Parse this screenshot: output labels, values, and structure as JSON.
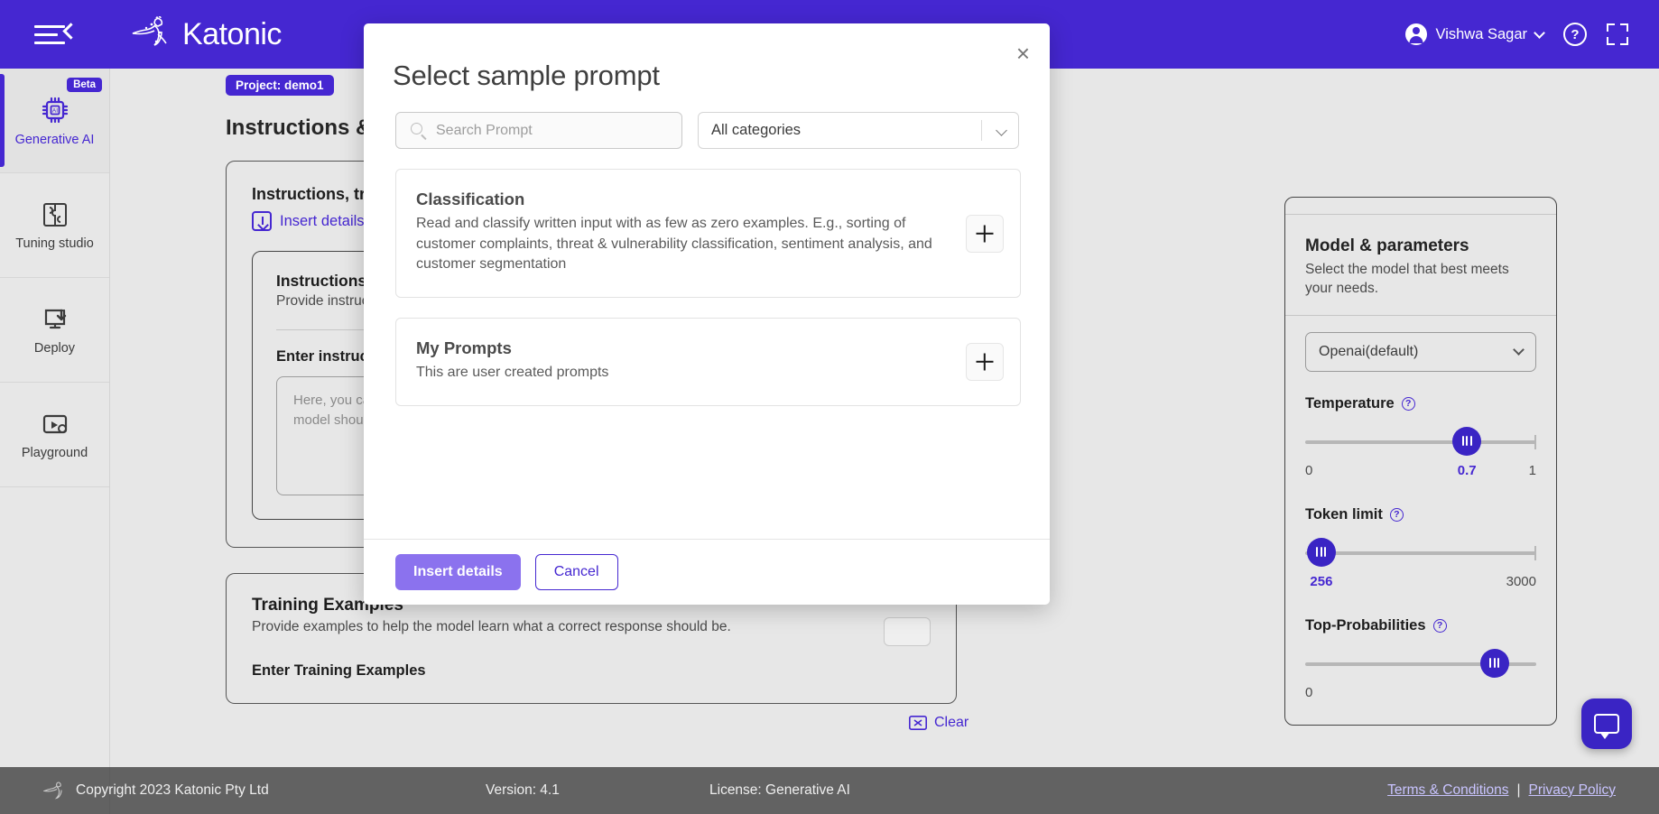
{
  "topbar": {
    "brand": "Katonic",
    "menu_icon": "hamburger-collapse-icon",
    "user_name": "Vishwa Sagar",
    "help_label": "?",
    "fullscreen_icon": "expand-icon"
  },
  "sidebar": {
    "items": [
      {
        "label": "Generative AI",
        "icon": "ai-chip-icon",
        "badge": "Beta",
        "active": true
      },
      {
        "label": "Tuning studio",
        "icon": "puzzle-icon",
        "badge": "",
        "active": false
      },
      {
        "label": "Deploy",
        "icon": "deploy-monitor-icon",
        "badge": "",
        "active": false
      },
      {
        "label": "Playground",
        "icon": "playground-icon",
        "badge": "",
        "active": false
      }
    ]
  },
  "page": {
    "project_chip": "Project: demo1",
    "title": "Instructions & Settings",
    "section_title": "Instructions, training examples and test i",
    "insert_link": "Insert details from sample prompt",
    "instructions_title": "Instructions",
    "instructions_sub": "Provide instructions to the model abou",
    "enter_instructions_label": "Enter instructions",
    "instructions_placeholder_line1": "Here, you can provide a clear descripti",
    "instructions_placeholder_line2": "model should respond to.",
    "training_title": "Training Examples",
    "training_sub": "Provide examples to help the model learn what a correct response should be.",
    "enter_training_label": "Enter Training Examples"
  },
  "params": {
    "title": "Model & parameters",
    "subtitle": "Select the model that best meets your needs.",
    "model_value": "Openai(default)",
    "temperature_label": "Temperature",
    "temperature_value": "0.7",
    "temperature_min": "0",
    "temperature_max": "1",
    "token_label": "Token limit",
    "token_value": "256",
    "token_min": "0",
    "token_max": "3000",
    "topp_label": "Top-Probabilities",
    "topp_min": "0"
  },
  "modal": {
    "title": "Select sample prompt",
    "close_label": "×",
    "search_placeholder": "Search Prompt",
    "search_value": "",
    "category_value": "All categories",
    "cards": [
      {
        "title": "Classification",
        "description": "Read and classify written input with as few as zero examples. E.g., sorting of customer complaints, threat & vulnerability classification, sentiment analysis, and customer segmentation",
        "add_label": "+"
      },
      {
        "title": "My Prompts",
        "description": "This are user created prompts",
        "add_label": "+"
      }
    ],
    "primary_button": "Insert details",
    "secondary_button": "Cancel"
  },
  "footer": {
    "copyright": "Copyright 2023 Katonic Pty Ltd",
    "version": "Version: 4.1",
    "license": "License: Generative AI",
    "terms": "Terms & Conditions",
    "separator": "|",
    "privacy": "Privacy Policy"
  },
  "misc": {
    "clear_label": "Clear",
    "chat_icon": "chat-bubble-icon"
  },
  "colors": {
    "brand_purple": "#4527d1",
    "accent_light_purple": "#8b72ee",
    "page_bg": "#e7e7e7"
  }
}
